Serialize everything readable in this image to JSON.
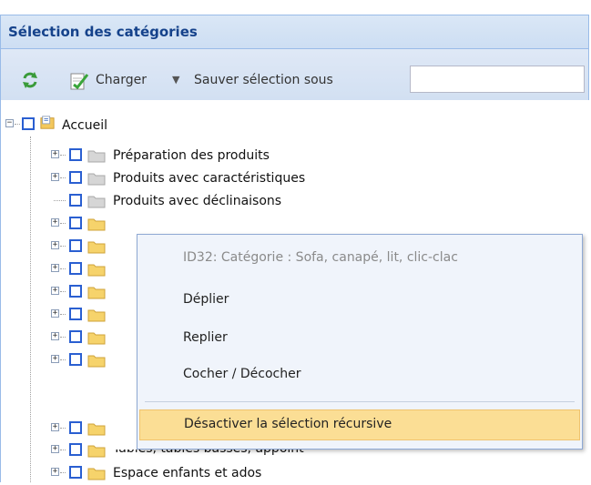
{
  "panel": {
    "title": "Sélection des catégories"
  },
  "toolbar": {
    "refresh_icon": "refresh-icon",
    "load_label": "Charger",
    "save_as_label": "Sauver sélection sous",
    "save_as_value": ""
  },
  "tree": {
    "root": {
      "label": "Accueil"
    },
    "items": [
      {
        "label": "Préparation des produits"
      },
      {
        "label": "Produits avec caractéristiques"
      },
      {
        "label": "Produits avec déclinaisons"
      },
      {
        "label": ""
      },
      {
        "label": ""
      },
      {
        "label": ""
      },
      {
        "label": ""
      },
      {
        "label": ""
      },
      {
        "label": ""
      },
      {
        "label": ""
      },
      {
        "label": "Tables, tables basses, appoint"
      },
      {
        "label": "Espace enfants et ados"
      }
    ]
  },
  "context_menu": {
    "header": "ID32: Catégorie : Sofa, canapé, lit, clic-clac",
    "items": [
      {
        "label": "Déplier"
      },
      {
        "label": "Replier"
      },
      {
        "label": "Cocher / Décocher"
      },
      {
        "label": "Désactiver la sélection récursive"
      }
    ]
  },
  "colors": {
    "header_bg": "#cddef3",
    "border": "#99bbe8",
    "checkbox": "#2a5fd1",
    "menu_highlight": "#fbde95"
  }
}
